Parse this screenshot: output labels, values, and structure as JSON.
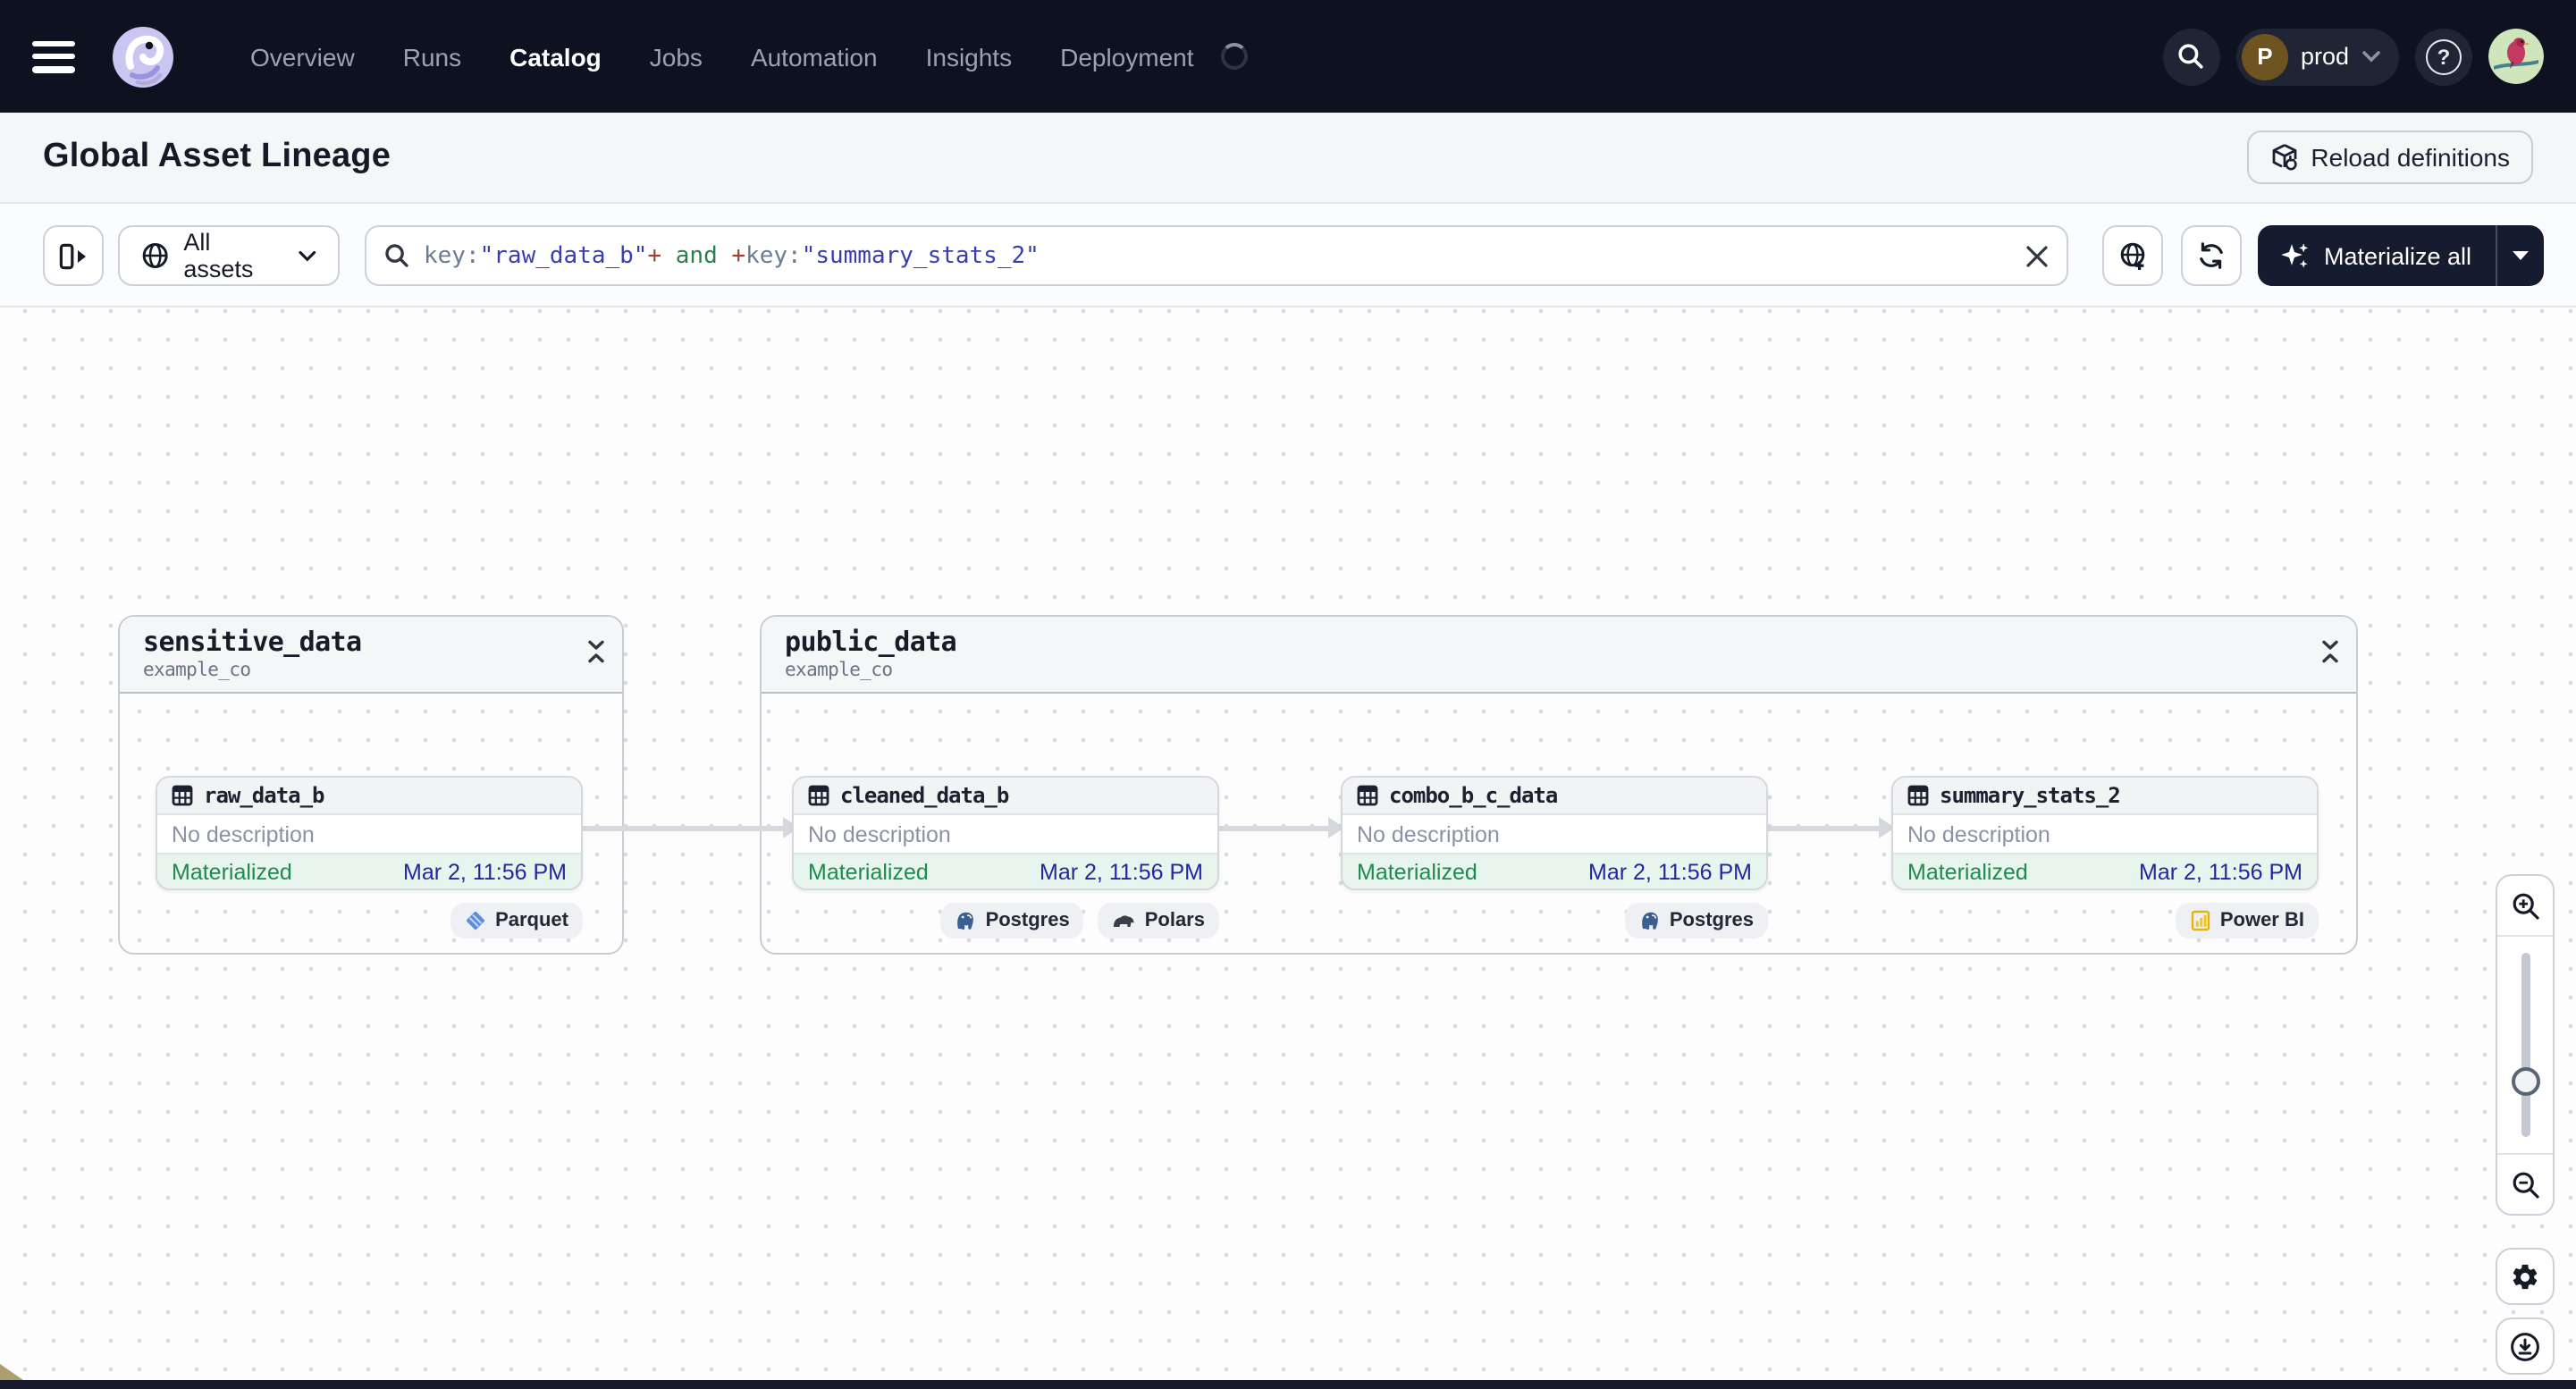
{
  "navbar": {
    "items": {
      "overview": "Overview",
      "runs": "Runs",
      "catalog": "Catalog",
      "jobs": "Jobs",
      "automation": "Automation",
      "insights": "Insights",
      "deployment": "Deployment"
    },
    "active_item": "Catalog",
    "environment": {
      "initial": "P",
      "name": "prod"
    },
    "help_glyph": "?"
  },
  "page_header": {
    "title": "Global Asset Lineage",
    "reload_button": "Reload definitions"
  },
  "toolbar": {
    "scope_button": "All assets",
    "query_tokens": {
      "t0": "key:",
      "t1": "\"raw_data_b\"",
      "t2": "+",
      "t3": " and ",
      "t4": "+",
      "t5": "key:",
      "t6": "\"summary_stats_2\""
    },
    "materialize_button": "Materialize all"
  },
  "graph": {
    "groups": [
      {
        "title": "sensitive_data",
        "subtitle": "example_co"
      },
      {
        "title": "public_data",
        "subtitle": "example_co"
      }
    ],
    "nodes": [
      {
        "name": "raw_data_b",
        "group": "sensitive_data",
        "description": "No description",
        "status": "Materialized",
        "timestamp": "Mar 2, 11:56 PM",
        "tags": [
          "Parquet"
        ]
      },
      {
        "name": "cleaned_data_b",
        "group": "public_data",
        "description": "No description",
        "status": "Materialized",
        "timestamp": "Mar 2, 11:56 PM",
        "tags": [
          "Postgres",
          "Polars"
        ]
      },
      {
        "name": "combo_b_c_data",
        "group": "public_data",
        "description": "No description",
        "status": "Materialized",
        "timestamp": "Mar 2, 11:56 PM",
        "tags": [
          "Postgres"
        ]
      },
      {
        "name": "summary_stats_2",
        "group": "public_data",
        "description": "No description",
        "status": "Materialized",
        "timestamp": "Mar 2, 11:56 PM",
        "tags": [
          "Power BI"
        ]
      }
    ],
    "edges": [
      {
        "from": "raw_data_b",
        "to": "cleaned_data_b"
      },
      {
        "from": "cleaned_data_b",
        "to": "combo_b_c_data"
      },
      {
        "from": "combo_b_c_data",
        "to": "summary_stats_2"
      }
    ]
  },
  "colors": {
    "navbar_bg": "#0d1120",
    "materialize_button_bg": "#151c30",
    "status_green": "#1f8a4e",
    "status_row_bg": "#e8f5ee",
    "timestamp_indigo": "#23279e",
    "query_string": "#3a3db0",
    "query_operator": "#9e4036",
    "query_keyword": "#2f7d4e"
  }
}
